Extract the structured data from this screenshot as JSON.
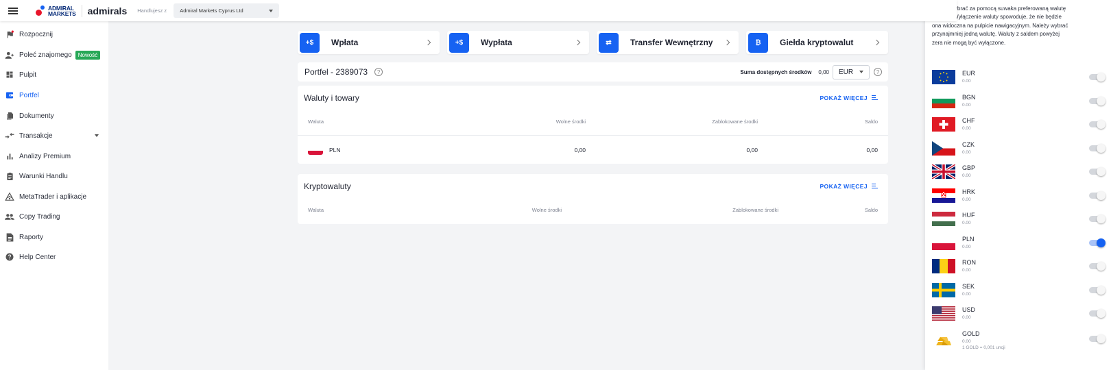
{
  "header": {
    "logo_text_line1": "ADMIRAL",
    "logo_text_line2": "MARKETS",
    "brand": "admirals",
    "trade_label": "Handlujesz z",
    "entity": "Admiral Markets Cyprus Ltd"
  },
  "sidebar": {
    "items": [
      {
        "label": "Rozpocznij",
        "icon": "flag-icon"
      },
      {
        "label": "Poleć znajomego",
        "icon": "add-person-icon",
        "badge": "Nowość"
      },
      {
        "label": "Pulpit",
        "icon": "dashboard-icon"
      },
      {
        "label": "Portfel",
        "icon": "wallet-icon",
        "active": true
      },
      {
        "label": "Dokumenty",
        "icon": "documents-icon"
      },
      {
        "label": "Transakcje",
        "icon": "transfer-arrows-icon",
        "expandable": true
      },
      {
        "label": "Analizy Premium",
        "icon": "bar-chart-icon"
      },
      {
        "label": "Warunki Handlu",
        "icon": "clipboard-icon"
      },
      {
        "label": "MetaTrader i aplikacje",
        "icon": "metatrader-icon"
      },
      {
        "label": "Copy Trading",
        "icon": "people-icon"
      },
      {
        "label": "Raporty",
        "icon": "report-icon"
      },
      {
        "label": "Help Center",
        "icon": "help-icon"
      }
    ]
  },
  "actions": [
    {
      "label": "Wpłata",
      "icon_text": "+$"
    },
    {
      "label": "Wypłata",
      "icon_text": "+$"
    },
    {
      "label": "Transfer Wewnętrzny",
      "icon_text": "⇄"
    },
    {
      "label": "Giełda kryptowalut",
      "icon_text": "₿"
    }
  ],
  "wallet": {
    "title": "Portfel - 2389073",
    "sum_label": "Suma dostępnych środków",
    "sum_value": "0,00",
    "currency": "EUR"
  },
  "fx_panel": {
    "title": "Waluty i towary",
    "show_more": "POKAŻ WIĘCEJ",
    "headers": [
      "Waluta",
      "Wolne środki",
      "Zablokowane środki",
      "Saldo"
    ],
    "rows": [
      {
        "currency": "PLN",
        "free": "0,00",
        "blocked": "0,00",
        "balance": "0,00"
      }
    ]
  },
  "crypto_panel": {
    "title": "Kryptowaluty",
    "show_more": "POKAŻ WIĘCEJ",
    "headers": [
      "Waluta",
      "Wolne środki",
      "Zablokowane środki",
      "Saldo"
    ]
  },
  "right_panel": {
    "info": "Proszę wybrać za pomocą suwaka preferowaną walutę portfela. Wyłączenie waluty spowoduje, że nie będzie ona widoczna na pulpicie nawigacyjnym. Należy wybrać przynajmniej jedną walutę. Waluty z saldem powyżej zera nie mogą być wyłączone.",
    "currencies": [
      {
        "code": "EUR",
        "amount": "0.00",
        "enabled": false
      },
      {
        "code": "BGN",
        "amount": "0.00",
        "enabled": false
      },
      {
        "code": "CHF",
        "amount": "0.00",
        "enabled": false
      },
      {
        "code": "CZK",
        "amount": "0.00",
        "enabled": false
      },
      {
        "code": "GBP",
        "amount": "0.00",
        "enabled": false
      },
      {
        "code": "HRK",
        "amount": "0.00",
        "enabled": false
      },
      {
        "code": "HUF",
        "amount": "0.00",
        "enabled": false
      },
      {
        "code": "PLN",
        "amount": "0.00",
        "enabled": true
      },
      {
        "code": "RON",
        "amount": "0.00",
        "enabled": false
      },
      {
        "code": "SEK",
        "amount": "0.00",
        "enabled": false
      },
      {
        "code": "USD",
        "amount": "0.00",
        "enabled": false
      },
      {
        "code": "GOLD",
        "amount": "0.00",
        "note": "1 GOLD = 0,001 uncji",
        "enabled": false
      }
    ]
  },
  "colors": {
    "accent": "#1662f2",
    "badge": "#27a857",
    "logo_red": "#e8162b"
  }
}
